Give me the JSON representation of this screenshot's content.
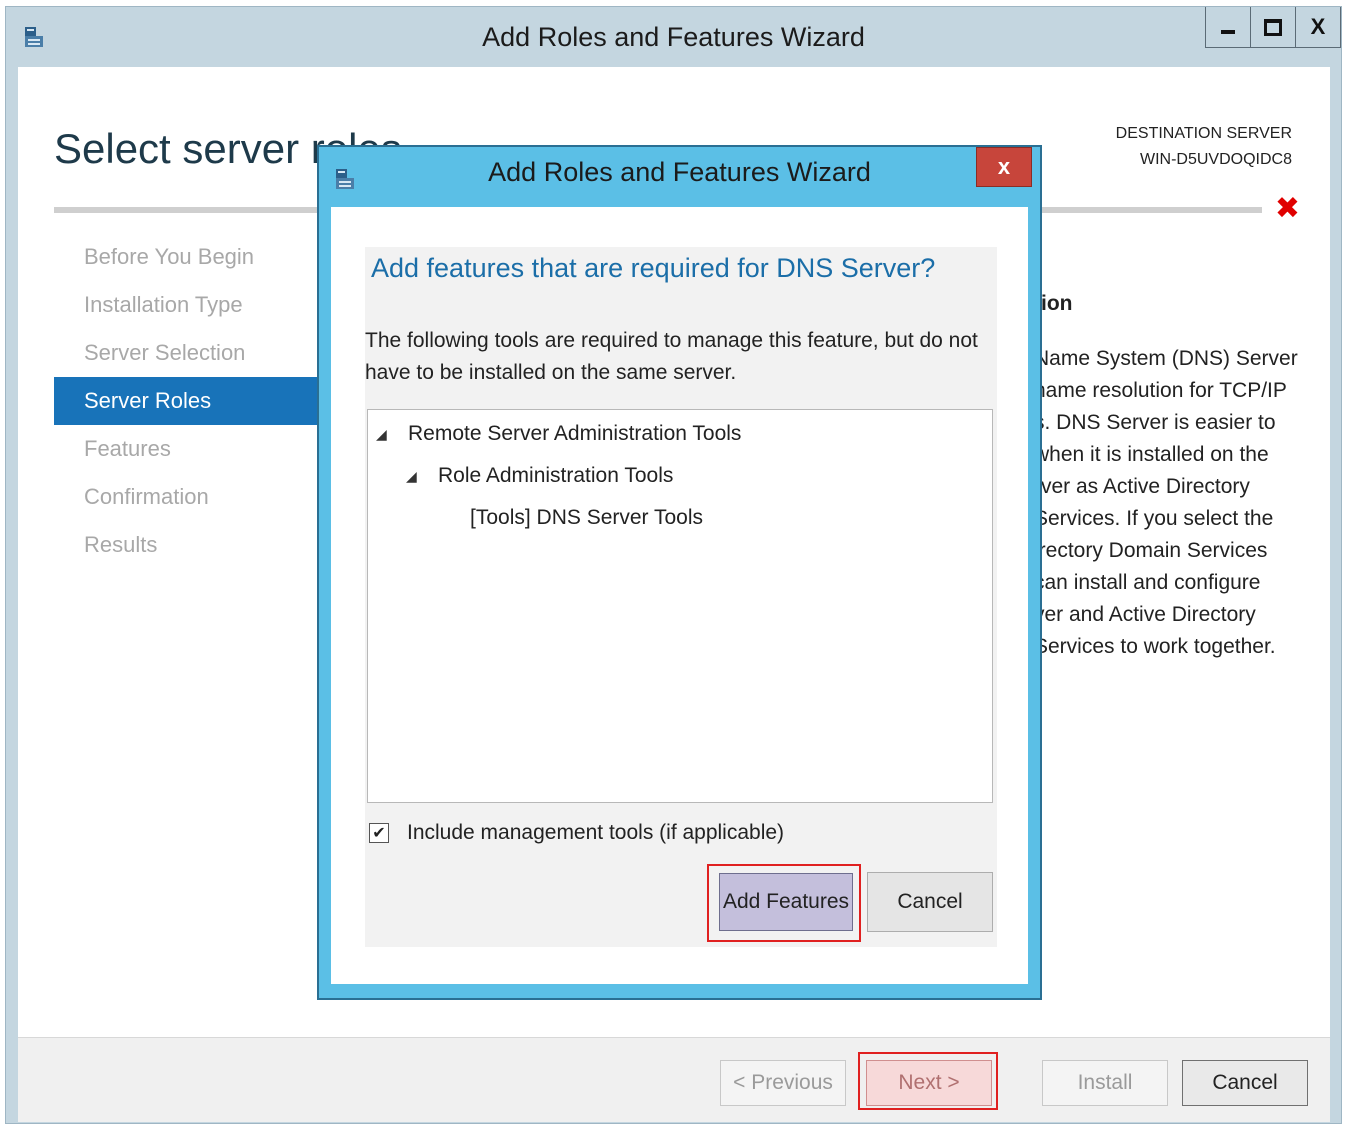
{
  "window": {
    "title": "Add Roles and Features Wizard"
  },
  "page": {
    "title": "Select server roles",
    "destination_label": "DESTINATION SERVER",
    "destination_server": "WIN-D5UVDOQIDC8"
  },
  "nav": {
    "items": [
      {
        "label": "Before You Begin",
        "active": false
      },
      {
        "label": "Installation Type",
        "active": false
      },
      {
        "label": "Server Selection",
        "active": false
      },
      {
        "label": "Server Roles",
        "active": true
      },
      {
        "label": "Features",
        "active": false
      },
      {
        "label": "Confirmation",
        "active": false
      },
      {
        "label": "Results",
        "active": false
      }
    ]
  },
  "description": {
    "heading": "tion",
    "lines": [
      "Name System (DNS) Server",
      "name resolution for TCP/IP",
      "s. DNS Server is easier to",
      "when it is installed on the",
      "rver as Active Directory",
      "Services. If you select the",
      "irectory Domain Services",
      "can install and configure",
      "ver and Active Directory",
      "Services to work together."
    ]
  },
  "footer": {
    "previous": "< Previous",
    "next": "Next >",
    "install": "Install",
    "cancel": "Cancel"
  },
  "dialog": {
    "title": "Add Roles and Features Wizard",
    "close": "x",
    "heading": "Add features that are required for DNS Server?",
    "text": "The following tools are required to manage this feature, but do not have to be installed on the same server.",
    "tree": [
      {
        "label": "Remote Server Administration Tools",
        "level": 0,
        "expanded": true
      },
      {
        "label": "Role Administration Tools",
        "level": 1,
        "expanded": true
      },
      {
        "label": "[Tools] DNS Server Tools",
        "level": 2,
        "expanded": false
      }
    ],
    "include_tools_label": "Include management tools (if applicable)",
    "include_tools_checked": true,
    "add_features": "Add Features",
    "cancel": "Cancel"
  },
  "colors": {
    "accent": "#1873b9",
    "dialog_frame": "#5bbfe6",
    "close_button": "#c7453b",
    "highlight": "#e02020",
    "error": "#e00000"
  }
}
